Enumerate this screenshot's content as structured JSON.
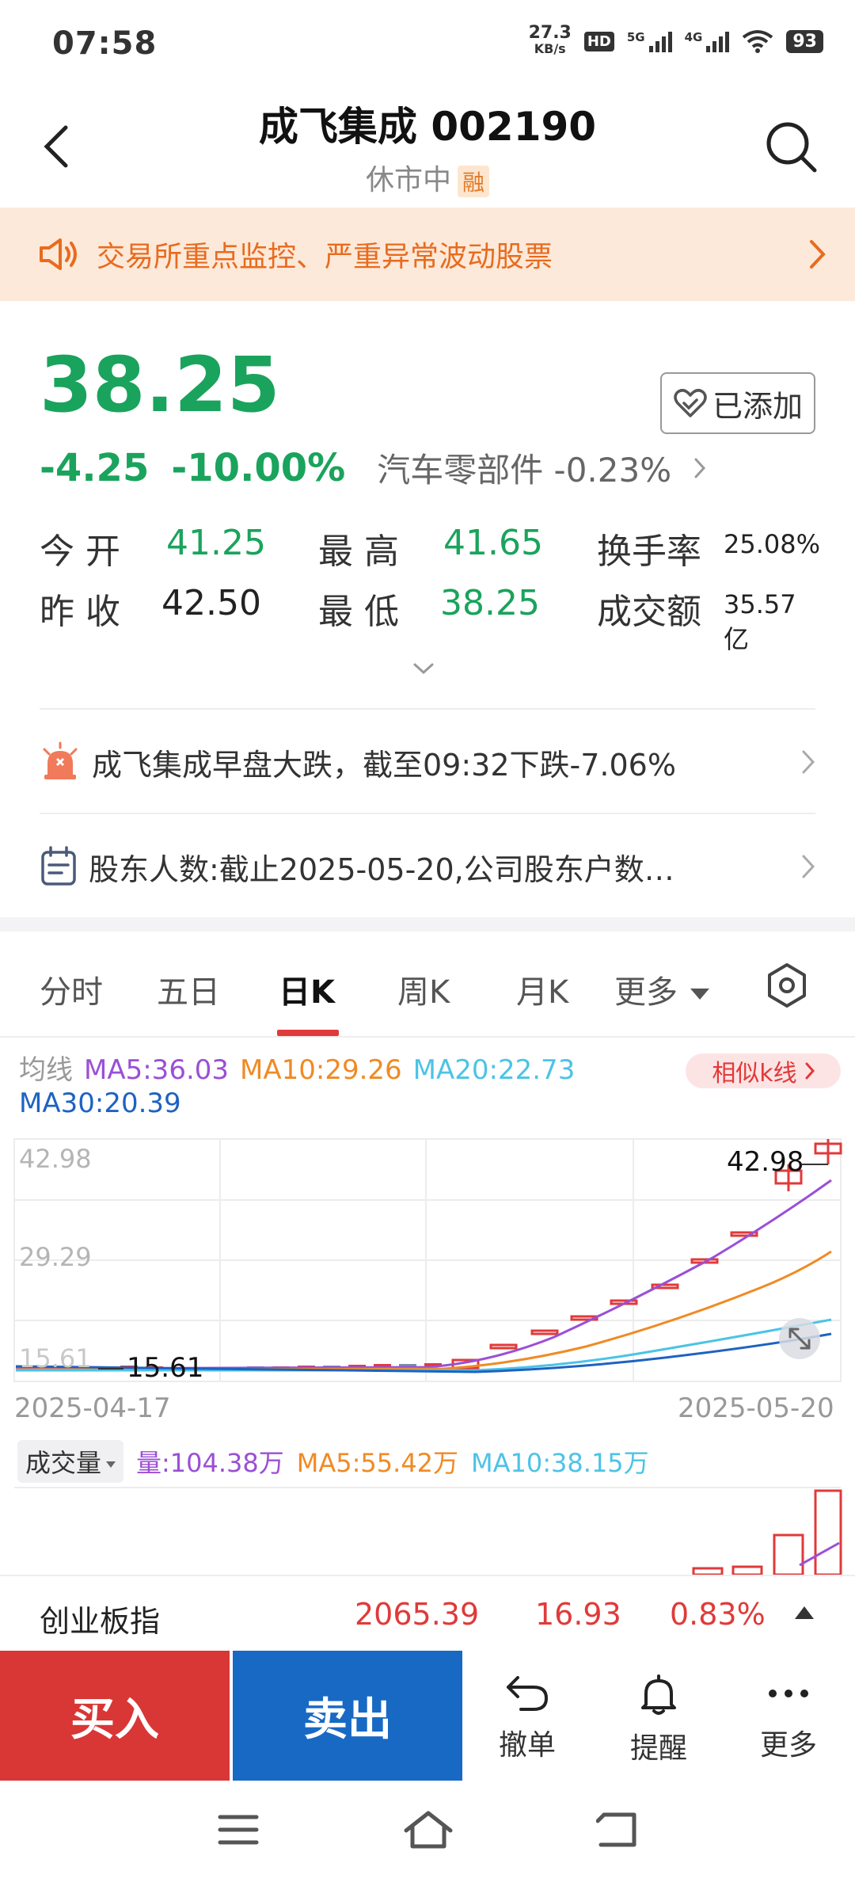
{
  "status_bar": {
    "time": "07:58",
    "net_speed_value": "27.3",
    "net_speed_unit": "KB/s",
    "hd_label": "HD",
    "sim1_label": "5G",
    "sim2_label": "4G",
    "battery": "93"
  },
  "header": {
    "title": "成飞集成 002190",
    "subtitle": "休市中",
    "badge": "融"
  },
  "alert": {
    "text": "交易所重点监控、严重异常波动股票"
  },
  "quote": {
    "price": "38.25",
    "change": "-4.25",
    "change_pct": "-10.00%",
    "sector": "汽车零部件 -0.23%",
    "watch_label": "已添加",
    "open_label": "今开",
    "open_value": "41.25",
    "high_label": "最高",
    "high_value": "41.65",
    "turnover_label": "换手率",
    "turnover_value": "25.08%",
    "prev_close_label": "昨收",
    "prev_close_value": "42.50",
    "low_label": "最低",
    "low_value": "38.25",
    "amount_label": "成交额",
    "amount_value": "35.57亿"
  },
  "news": [
    {
      "text": "成飞集成早盘大跌，截至09:32下跌-7.06%",
      "icon": "alarm-icon"
    },
    {
      "text": "股东人数:截止2025-05-20,公司股东户数…",
      "icon": "calendar-icon"
    }
  ],
  "tabs": {
    "items": [
      "分时",
      "五日",
      "日K",
      "周K",
      "月K"
    ],
    "more": "更多",
    "active_index": 2
  },
  "ma_legend": {
    "label": "均线",
    "ma5": "MA5:36.03",
    "ma10": "MA10:29.26",
    "ma20": "MA20:22.73",
    "ma30": "MA30:20.39",
    "similar": "相似k线"
  },
  "colors": {
    "up": "#e03a3a",
    "down": "#1aa35c",
    "ma5": "#9b4fd6",
    "ma10": "#f08a24",
    "ma20": "#4cc3e6",
    "ma30": "#1e62c2"
  },
  "chart_data": {
    "type": "candlestick",
    "y_ticks": [
      "42.98",
      "29.29",
      "15.61"
    ],
    "max_label": "42.98",
    "min_label": "15.61",
    "start_date": "2025-04-17",
    "end_date": "2025-05-20",
    "ylim": [
      15.61,
      42.98
    ]
  },
  "volume": {
    "selector": "成交量",
    "vol": "量:104.38万",
    "ma5": "MA5:55.42万",
    "ma10": "MA10:38.15万"
  },
  "index_bar": {
    "name": "创业板指",
    "value": "2065.39",
    "change": "16.93",
    "change_pct": "0.83%"
  },
  "actions": {
    "buy": "买入",
    "sell": "卖出",
    "cancel": "撤单",
    "remind": "提醒",
    "more": "更多"
  }
}
